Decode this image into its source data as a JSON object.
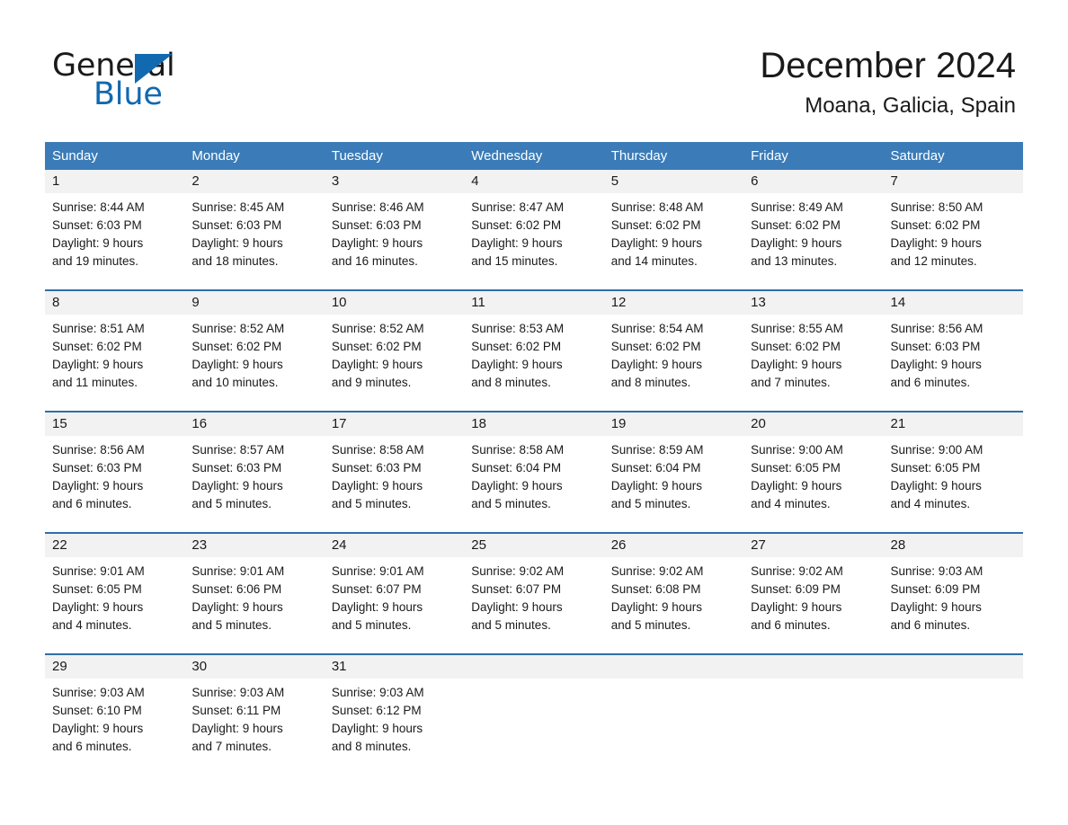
{
  "brand": {
    "name_part1": "General",
    "name_part2": "Blue",
    "accent_color": "#1169b0"
  },
  "header": {
    "title": "December 2024",
    "subtitle": "Moana, Galicia, Spain"
  },
  "calendar": {
    "header_bg": "#3b7cb8",
    "row_border": "#2f6fab",
    "day_number_bg": "#f2f2f2",
    "weekdays": [
      "Sunday",
      "Monday",
      "Tuesday",
      "Wednesday",
      "Thursday",
      "Friday",
      "Saturday"
    ],
    "weeks": [
      [
        {
          "day": "1",
          "sunrise": "Sunrise: 8:44 AM",
          "sunset": "Sunset: 6:03 PM",
          "daylight_line1": "Daylight: 9 hours",
          "daylight_line2": "and 19 minutes."
        },
        {
          "day": "2",
          "sunrise": "Sunrise: 8:45 AM",
          "sunset": "Sunset: 6:03 PM",
          "daylight_line1": "Daylight: 9 hours",
          "daylight_line2": "and 18 minutes."
        },
        {
          "day": "3",
          "sunrise": "Sunrise: 8:46 AM",
          "sunset": "Sunset: 6:03 PM",
          "daylight_line1": "Daylight: 9 hours",
          "daylight_line2": "and 16 minutes."
        },
        {
          "day": "4",
          "sunrise": "Sunrise: 8:47 AM",
          "sunset": "Sunset: 6:02 PM",
          "daylight_line1": "Daylight: 9 hours",
          "daylight_line2": "and 15 minutes."
        },
        {
          "day": "5",
          "sunrise": "Sunrise: 8:48 AM",
          "sunset": "Sunset: 6:02 PM",
          "daylight_line1": "Daylight: 9 hours",
          "daylight_line2": "and 14 minutes."
        },
        {
          "day": "6",
          "sunrise": "Sunrise: 8:49 AM",
          "sunset": "Sunset: 6:02 PM",
          "daylight_line1": "Daylight: 9 hours",
          "daylight_line2": "and 13 minutes."
        },
        {
          "day": "7",
          "sunrise": "Sunrise: 8:50 AM",
          "sunset": "Sunset: 6:02 PM",
          "daylight_line1": "Daylight: 9 hours",
          "daylight_line2": "and 12 minutes."
        }
      ],
      [
        {
          "day": "8",
          "sunrise": "Sunrise: 8:51 AM",
          "sunset": "Sunset: 6:02 PM",
          "daylight_line1": "Daylight: 9 hours",
          "daylight_line2": "and 11 minutes."
        },
        {
          "day": "9",
          "sunrise": "Sunrise: 8:52 AM",
          "sunset": "Sunset: 6:02 PM",
          "daylight_line1": "Daylight: 9 hours",
          "daylight_line2": "and 10 minutes."
        },
        {
          "day": "10",
          "sunrise": "Sunrise: 8:52 AM",
          "sunset": "Sunset: 6:02 PM",
          "daylight_line1": "Daylight: 9 hours",
          "daylight_line2": "and 9 minutes."
        },
        {
          "day": "11",
          "sunrise": "Sunrise: 8:53 AM",
          "sunset": "Sunset: 6:02 PM",
          "daylight_line1": "Daylight: 9 hours",
          "daylight_line2": "and 8 minutes."
        },
        {
          "day": "12",
          "sunrise": "Sunrise: 8:54 AM",
          "sunset": "Sunset: 6:02 PM",
          "daylight_line1": "Daylight: 9 hours",
          "daylight_line2": "and 8 minutes."
        },
        {
          "day": "13",
          "sunrise": "Sunrise: 8:55 AM",
          "sunset": "Sunset: 6:02 PM",
          "daylight_line1": "Daylight: 9 hours",
          "daylight_line2": "and 7 minutes."
        },
        {
          "day": "14",
          "sunrise": "Sunrise: 8:56 AM",
          "sunset": "Sunset: 6:03 PM",
          "daylight_line1": "Daylight: 9 hours",
          "daylight_line2": "and 6 minutes."
        }
      ],
      [
        {
          "day": "15",
          "sunrise": "Sunrise: 8:56 AM",
          "sunset": "Sunset: 6:03 PM",
          "daylight_line1": "Daylight: 9 hours",
          "daylight_line2": "and 6 minutes."
        },
        {
          "day": "16",
          "sunrise": "Sunrise: 8:57 AM",
          "sunset": "Sunset: 6:03 PM",
          "daylight_line1": "Daylight: 9 hours",
          "daylight_line2": "and 5 minutes."
        },
        {
          "day": "17",
          "sunrise": "Sunrise: 8:58 AM",
          "sunset": "Sunset: 6:03 PM",
          "daylight_line1": "Daylight: 9 hours",
          "daylight_line2": "and 5 minutes."
        },
        {
          "day": "18",
          "sunrise": "Sunrise: 8:58 AM",
          "sunset": "Sunset: 6:04 PM",
          "daylight_line1": "Daylight: 9 hours",
          "daylight_line2": "and 5 minutes."
        },
        {
          "day": "19",
          "sunrise": "Sunrise: 8:59 AM",
          "sunset": "Sunset: 6:04 PM",
          "daylight_line1": "Daylight: 9 hours",
          "daylight_line2": "and 5 minutes."
        },
        {
          "day": "20",
          "sunrise": "Sunrise: 9:00 AM",
          "sunset": "Sunset: 6:05 PM",
          "daylight_line1": "Daylight: 9 hours",
          "daylight_line2": "and 4 minutes."
        },
        {
          "day": "21",
          "sunrise": "Sunrise: 9:00 AM",
          "sunset": "Sunset: 6:05 PM",
          "daylight_line1": "Daylight: 9 hours",
          "daylight_line2": "and 4 minutes."
        }
      ],
      [
        {
          "day": "22",
          "sunrise": "Sunrise: 9:01 AM",
          "sunset": "Sunset: 6:05 PM",
          "daylight_line1": "Daylight: 9 hours",
          "daylight_line2": "and 4 minutes."
        },
        {
          "day": "23",
          "sunrise": "Sunrise: 9:01 AM",
          "sunset": "Sunset: 6:06 PM",
          "daylight_line1": "Daylight: 9 hours",
          "daylight_line2": "and 5 minutes."
        },
        {
          "day": "24",
          "sunrise": "Sunrise: 9:01 AM",
          "sunset": "Sunset: 6:07 PM",
          "daylight_line1": "Daylight: 9 hours",
          "daylight_line2": "and 5 minutes."
        },
        {
          "day": "25",
          "sunrise": "Sunrise: 9:02 AM",
          "sunset": "Sunset: 6:07 PM",
          "daylight_line1": "Daylight: 9 hours",
          "daylight_line2": "and 5 minutes."
        },
        {
          "day": "26",
          "sunrise": "Sunrise: 9:02 AM",
          "sunset": "Sunset: 6:08 PM",
          "daylight_line1": "Daylight: 9 hours",
          "daylight_line2": "and 5 minutes."
        },
        {
          "day": "27",
          "sunrise": "Sunrise: 9:02 AM",
          "sunset": "Sunset: 6:09 PM",
          "daylight_line1": "Daylight: 9 hours",
          "daylight_line2": "and 6 minutes."
        },
        {
          "day": "28",
          "sunrise": "Sunrise: 9:03 AM",
          "sunset": "Sunset: 6:09 PM",
          "daylight_line1": "Daylight: 9 hours",
          "daylight_line2": "and 6 minutes."
        }
      ],
      [
        {
          "day": "29",
          "sunrise": "Sunrise: 9:03 AM",
          "sunset": "Sunset: 6:10 PM",
          "daylight_line1": "Daylight: 9 hours",
          "daylight_line2": "and 6 minutes."
        },
        {
          "day": "30",
          "sunrise": "Sunrise: 9:03 AM",
          "sunset": "Sunset: 6:11 PM",
          "daylight_line1": "Daylight: 9 hours",
          "daylight_line2": "and 7 minutes."
        },
        {
          "day": "31",
          "sunrise": "Sunrise: 9:03 AM",
          "sunset": "Sunset: 6:12 PM",
          "daylight_line1": "Daylight: 9 hours",
          "daylight_line2": "and 8 minutes."
        },
        {
          "day": "",
          "sunrise": "",
          "sunset": "",
          "daylight_line1": "",
          "daylight_line2": ""
        },
        {
          "day": "",
          "sunrise": "",
          "sunset": "",
          "daylight_line1": "",
          "daylight_line2": ""
        },
        {
          "day": "",
          "sunrise": "",
          "sunset": "",
          "daylight_line1": "",
          "daylight_line2": ""
        },
        {
          "day": "",
          "sunrise": "",
          "sunset": "",
          "daylight_line1": "",
          "daylight_line2": ""
        }
      ]
    ]
  }
}
